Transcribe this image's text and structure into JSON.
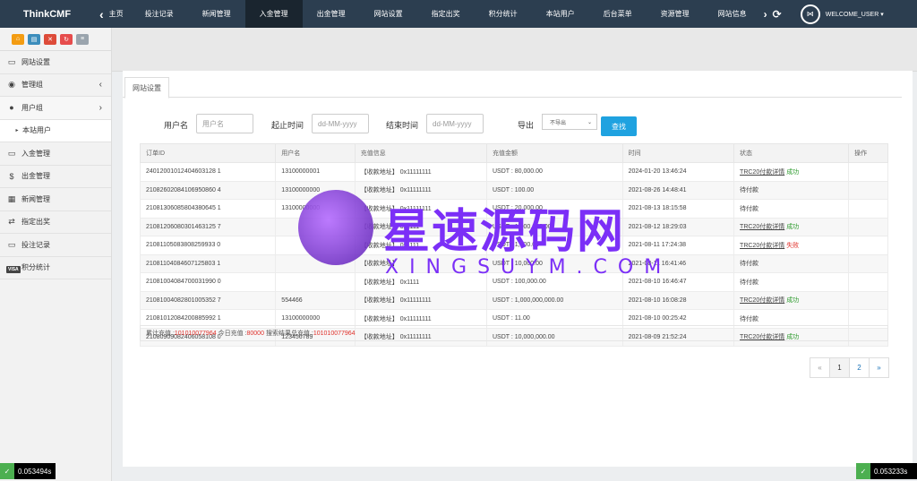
{
  "nav": {
    "brand": "ThinkCMF",
    "home_label": "主页",
    "items": [
      {
        "label": "投注记录"
      },
      {
        "label": "新闻管理"
      },
      {
        "label": "入金管理",
        "active": true
      },
      {
        "label": "出金管理"
      },
      {
        "label": "网站设置"
      },
      {
        "label": "指定出奖"
      },
      {
        "label": "积分统计"
      },
      {
        "label": "本站用户"
      },
      {
        "label": "后台菜单"
      },
      {
        "label": "资源管理"
      },
      {
        "label": "网站信息"
      }
    ],
    "user": "WELCOME_USER ▾"
  },
  "sidebar": {
    "quick_colors": [
      "#f39c12",
      "#3c8dbc",
      "#dd4b39",
      "#e64c4c",
      "#9aa4ad"
    ],
    "items": [
      {
        "label": "网站设置",
        "icon": "monitor-icon"
      },
      {
        "label": "管理组",
        "icon": "user-circle-icon",
        "arrow": "‹"
      },
      {
        "label": "用户组",
        "icon": "user-icon",
        "arrow": "›"
      },
      {
        "label": "本站用户",
        "icon": "bullet-icon",
        "sub": true
      },
      {
        "label": "入金管理",
        "icon": "monitor-icon"
      },
      {
        "label": "出金管理",
        "icon": "dollar-icon"
      },
      {
        "label": "新闻管理",
        "icon": "news-icon"
      },
      {
        "label": "指定出奖",
        "icon": "exchange-icon"
      },
      {
        "label": "投注记录",
        "icon": "monitor-icon"
      },
      {
        "label": "积分统计",
        "icon": "visa-icon"
      }
    ]
  },
  "tab": {
    "label": "网站设置"
  },
  "search": {
    "username_label": "用户名",
    "username_placeholder": "用户名",
    "start_label": "起止时间",
    "start_placeholder": "dd-MM-yyyy",
    "end_label": "结束时间",
    "end_placeholder": "dd-MM-yyyy",
    "export_label": "导出",
    "export_value": "不导出",
    "search_button": "查找"
  },
  "table": {
    "columns": [
      "订单ID",
      "用户名",
      "充值信息",
      "充值金额",
      "时间",
      "状态",
      "操作"
    ],
    "rows": [
      {
        "id": "24012001012404603128 1",
        "user": "13100000001",
        "info": "【收款地址】 0x11111111",
        "amount": "USDT : 80,000.00",
        "time": "2024-01-20 13:46:24",
        "status_link": "TRC20付款详情",
        "status_extra": "成功",
        "status_type": "ok"
      },
      {
        "id": "21082602084106950860 4",
        "user": "13100000000",
        "info": "【收款地址】 0x11111111",
        "amount": "USDT : 100.00",
        "time": "2021-08-26 14:48:41",
        "status_link": "",
        "status_extra": "待付款",
        "status_type": "plain"
      },
      {
        "id": "21081306085804380645 1",
        "user": "13100000000",
        "info": "【收款地址】 0x11111111",
        "amount": "USDT : 20,000.00",
        "time": "2021-08-13 18:15:58",
        "status_link": "",
        "status_extra": "待付款",
        "status_type": "plain"
      },
      {
        "id": "21081206080301463125 7",
        "user": "",
        "info": "【收款地址】 0x1111",
        "amount": "USDT : 1,000,000.00",
        "time": "2021-08-12 18:29:03",
        "status_link": "TRC20付款详情",
        "status_extra": "成功",
        "status_type": "ok"
      },
      {
        "id": "21081105083808259933 0",
        "user": "",
        "info": "【收款地址】 0x1111",
        "amount": "USDT : 1,000.00",
        "time": "2021-08-11 17:24:38",
        "status_link": "TRC20付款详情",
        "status_extra": "失败",
        "status_type": "fail"
      },
      {
        "id": "21081104084607125803 1",
        "user": "",
        "info": "【收款地址】",
        "amount": "USDT : 10,000.00",
        "time": "2021-08-11 16:41:46",
        "status_link": "",
        "status_extra": "待付款",
        "status_type": "plain"
      },
      {
        "id": "21081004084700031990 0",
        "user": "",
        "info": "【收款地址】 0x1111",
        "amount": "USDT : 100,000.00",
        "time": "2021-08-10 16:46:47",
        "status_link": "",
        "status_extra": "待付款",
        "status_type": "plain"
      },
      {
        "id": "21081004082801005352 7",
        "user": "554466",
        "info": "【收款地址】 0x11111111",
        "amount": "USDT : 1,000,000,000.00",
        "time": "2021-08-10 16:08:28",
        "status_link": "TRC20付款详情",
        "status_extra": "成功",
        "status_type": "ok"
      },
      {
        "id": "21081012084200885992 1",
        "user": "13100000000",
        "info": "【收款地址】 0x11111111",
        "amount": "USDT : 11.00",
        "time": "2021-08-10 00:25:42",
        "status_link": "",
        "status_extra": "待付款",
        "status_type": "plain"
      },
      {
        "id": "21080909082406058108 0",
        "user": "123456789",
        "info": "【收款地址】 0x11111111",
        "amount": "USDT : 10,000,000.00",
        "time": "2021-08-09 21:52:24",
        "status_link": "TRC20付款详情",
        "status_extra": "成功",
        "status_type": "ok"
      }
    ]
  },
  "summary": {
    "total_label": "累计充值 :",
    "total_value": "101010077964",
    "today_label": "今日充值 :",
    "today_value": "80000",
    "result_label": "搜索结果总充值 :",
    "result_value": "101010077964"
  },
  "pager": {
    "prev": "«",
    "pages": [
      "1",
      "2"
    ],
    "next": "»"
  },
  "watermark": {
    "big": "星速源码网",
    "small": "XINGSUYM.COM"
  },
  "timers": {
    "left": "0.053494s",
    "right": "0.053233s"
  }
}
